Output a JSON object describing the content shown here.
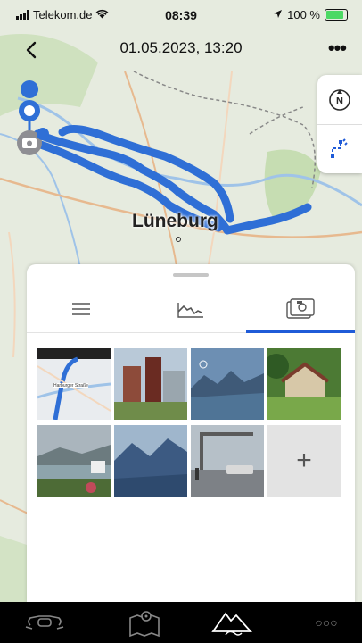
{
  "status_bar": {
    "carrier": "Telekom.de",
    "time": "08:39",
    "battery_percent": "100 %",
    "battery_level": 1.0
  },
  "nav": {
    "title": "01.05.2023, 13:20",
    "back_icon": "chevron-left-icon",
    "more_label": "•••"
  },
  "map": {
    "place_label": "Lüneburg",
    "route_color": "#2f6fd6",
    "side_tools": [
      "compass-north-icon",
      "route-edit-icon"
    ]
  },
  "sheet": {
    "tabs": [
      {
        "icon": "list-icon",
        "selected": false
      },
      {
        "icon": "elevation-profile-icon",
        "selected": false
      },
      {
        "icon": "photo-gallery-icon",
        "selected": true
      }
    ],
    "photos": [
      {
        "icon": "photo-map-screenshot",
        "caption": "Harburger Straße"
      },
      {
        "icon": "photo-city-buildings"
      },
      {
        "icon": "photo-mountains-app"
      },
      {
        "icon": "photo-garden-house"
      },
      {
        "icon": "photo-lake-view"
      },
      {
        "icon": "photo-mountain-valley"
      },
      {
        "icon": "photo-ferry-dock"
      }
    ],
    "add_label": "+"
  },
  "tab_bar": {
    "items": [
      "motorcycle-icon",
      "map-icon",
      "mountain-route-icon",
      "more-dots-icon"
    ],
    "more_label": "○○○",
    "active_index": 2
  },
  "colors": {
    "accent": "#1f5bd8",
    "tab_bar": "#000000"
  }
}
